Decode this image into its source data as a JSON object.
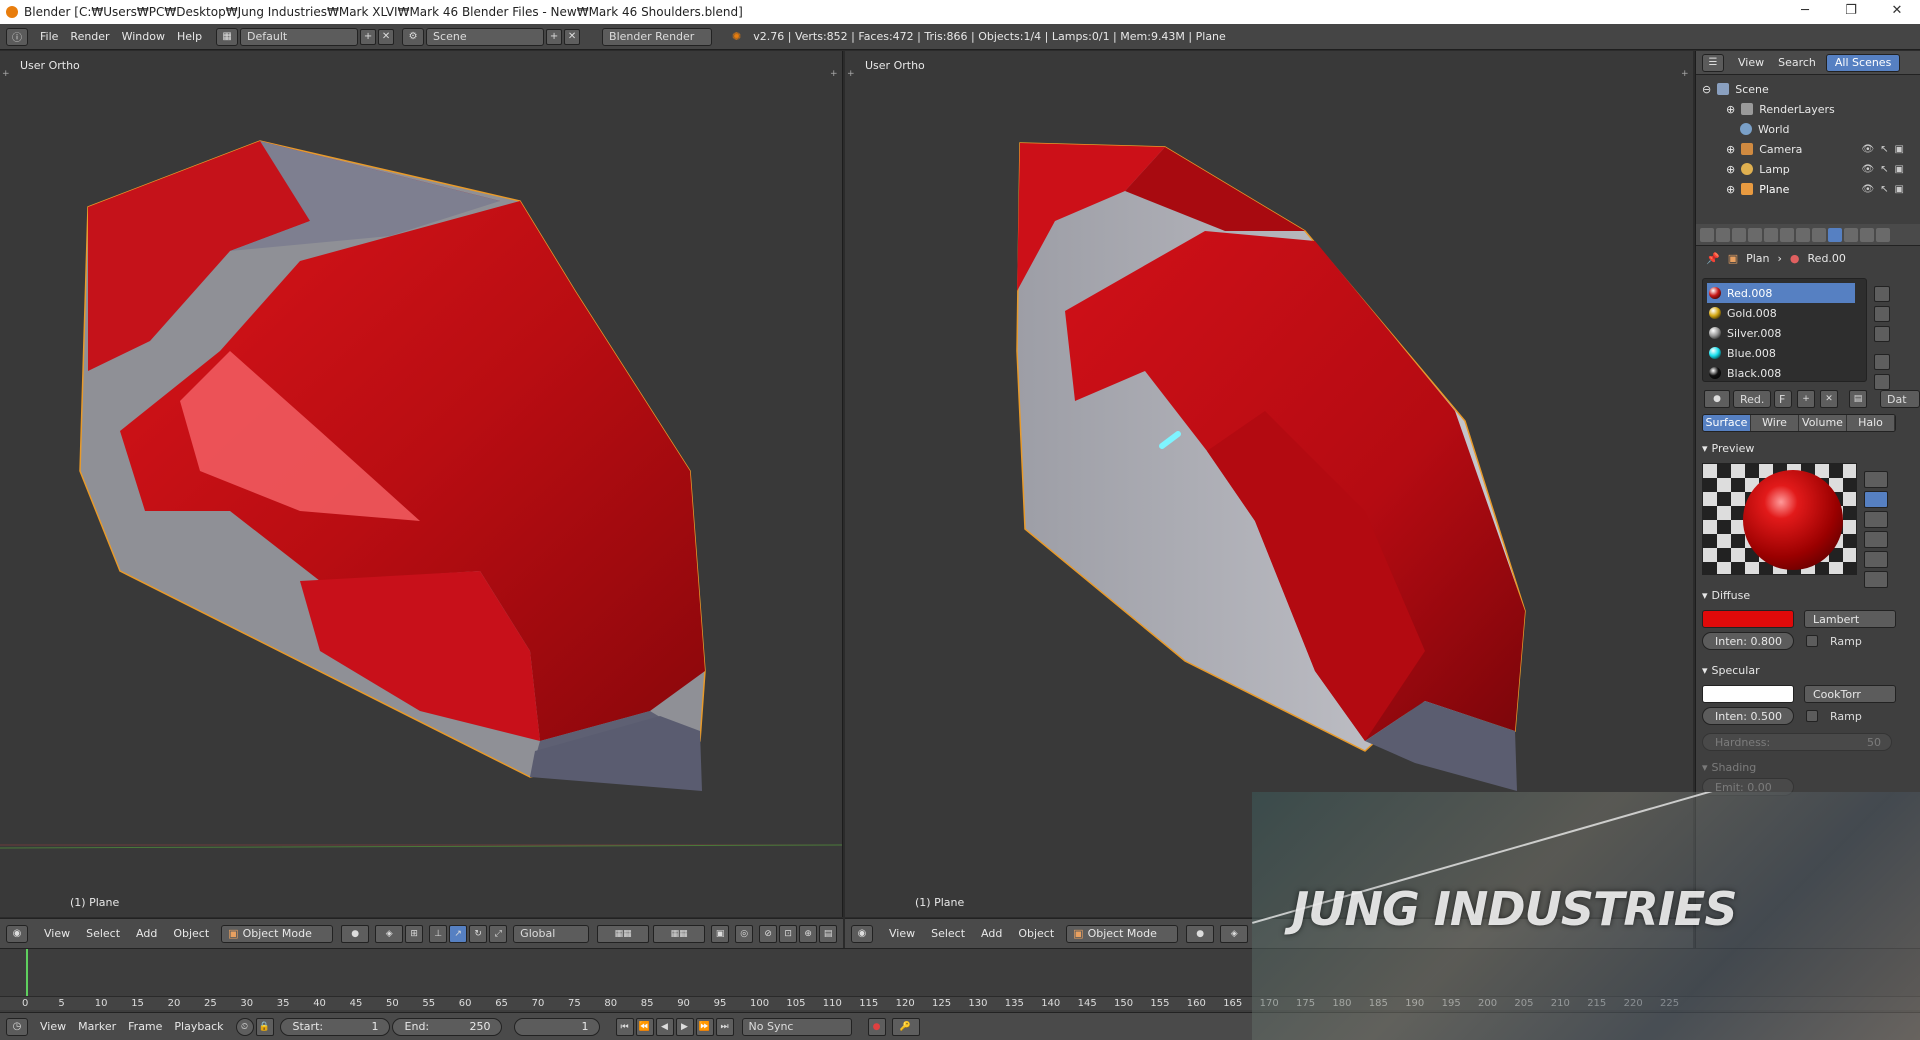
{
  "titlebar": {
    "title": "Blender [C:₩Users₩PC₩Desktop₩Jung Industries₩Mark XLVI₩Mark 46 Blender Files - New₩Mark 46 Shoulders.blend]",
    "min": "─",
    "max": "❐",
    "close": "✕"
  },
  "infobar": {
    "menus": [
      "File",
      "Render",
      "Window",
      "Help"
    ],
    "layout": "Default",
    "scene": "Scene",
    "engine": "Blender Render",
    "stats": "v2.76 | Verts:852 | Faces:472 | Tris:866 | Objects:1/4 | Lamps:0/1 | Mem:9.43M | Plane"
  },
  "viewport_left": {
    "label": "User Ortho",
    "object": "(1) Plane"
  },
  "viewport_right": {
    "label": "User Ortho",
    "object": "(1) Plane"
  },
  "vp_header": {
    "menus": [
      "View",
      "Select",
      "Add",
      "Object"
    ],
    "mode": "Object Mode",
    "orientation": "Global"
  },
  "timeline": {
    "ticks": [
      "0",
      "5",
      "10",
      "15",
      "20",
      "25",
      "30",
      "35",
      "40",
      "45",
      "50",
      "55",
      "60",
      "65",
      "70",
      "75",
      "80",
      "85",
      "90",
      "95",
      "100",
      "105",
      "110",
      "115",
      "120",
      "125",
      "130",
      "135",
      "140",
      "145",
      "150",
      "155",
      "160",
      "165",
      "170",
      "175",
      "180",
      "185",
      "190",
      "195",
      "200",
      "205",
      "210",
      "215",
      "220",
      "225"
    ],
    "menus": [
      "View",
      "Marker",
      "Frame",
      "Playback"
    ],
    "start_label": "Start:",
    "start": "1",
    "end_label": "End:",
    "end": "250",
    "current": "1",
    "sync": "No Sync"
  },
  "outliner": {
    "menus": [
      "View",
      "Search"
    ],
    "all_scenes": "All Scenes",
    "items": [
      "Scene",
      "RenderLayers",
      "World",
      "Camera",
      "Lamp",
      "Plane"
    ]
  },
  "props": {
    "crumb_obj": "Plan",
    "crumb_mat": "Red.00",
    "materials": [
      {
        "name": "Red.008",
        "color": "#c81818"
      },
      {
        "name": "Gold.008",
        "color": "#d4a814"
      },
      {
        "name": "Silver.008",
        "color": "#9a9a9a"
      },
      {
        "name": "Blue.008",
        "color": "#19e0ee"
      },
      {
        "name": "Black.008",
        "color": "#101010"
      }
    ],
    "slot_name": "Red.",
    "slot_f": "F",
    "data_label": "Dat",
    "tabs": [
      "Surface",
      "Wire",
      "Volume",
      "Halo"
    ],
    "preview_title": "Preview",
    "diffuse_title": "Diffuse",
    "diffuse_color": "#e00a0a",
    "diffuse_shader": "Lambert",
    "diffuse_inten": "Inten: 0.800",
    "ramp": "Ramp",
    "specular_title": "Specular",
    "specular_color": "#ffffff",
    "specular_shader": "CookTorr",
    "specular_inten": "Inten: 0.500",
    "hardness": "Hardness:",
    "hardness_val": "50",
    "shading_title": "Shading",
    "emit": "Emit: 0.00"
  },
  "watermark": {
    "text": "JUNG INDUSTRIES"
  }
}
